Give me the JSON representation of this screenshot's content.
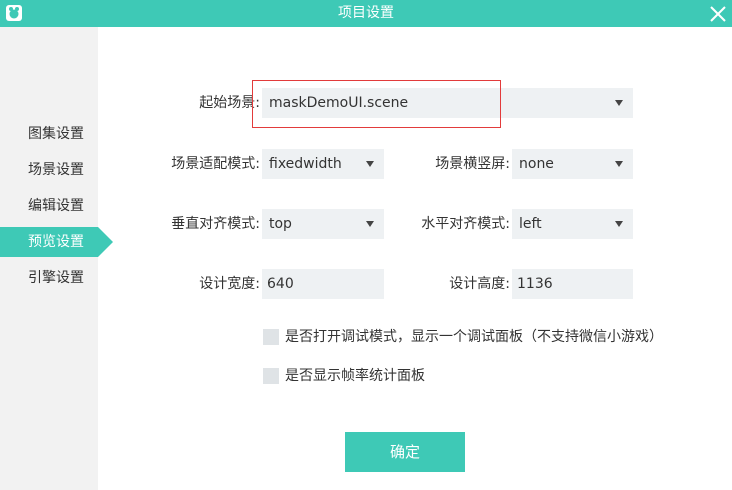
{
  "window": {
    "title": "项目设置",
    "accent_color": "#3ec9b6",
    "app_icon": "app-logo-icon",
    "close_icon": "close-icon"
  },
  "sidebar": {
    "items": [
      {
        "label": "图集设置",
        "active": false
      },
      {
        "label": "场景设置",
        "active": false
      },
      {
        "label": "编辑设置",
        "active": false
      },
      {
        "label": "预览设置",
        "active": true
      },
      {
        "label": "引擎设置",
        "active": false
      }
    ]
  },
  "form": {
    "start_scene": {
      "label": "起始场景:",
      "value": "maskDemoUI.scene"
    },
    "scale_mode": {
      "label": "场景适配模式:",
      "value": "fixedwidth"
    },
    "screen_mode": {
      "label": "场景横竖屏:",
      "value": "none"
    },
    "valign": {
      "label": "垂直对齐模式:",
      "value": "top"
    },
    "halign": {
      "label": "水平对齐模式:",
      "value": "left"
    },
    "design_width": {
      "label": "设计宽度:",
      "value": "640"
    },
    "design_height": {
      "label": "设计高度:",
      "value": "1136"
    },
    "debug_mode": {
      "label": "是否打开调试模式，显示一个调试面板（不支持微信小游戏）",
      "checked": false
    },
    "show_stats": {
      "label": "是否显示帧率统计面板",
      "checked": false
    }
  },
  "confirm_button": {
    "label": "确定"
  },
  "highlight_color": "#e23b3b"
}
